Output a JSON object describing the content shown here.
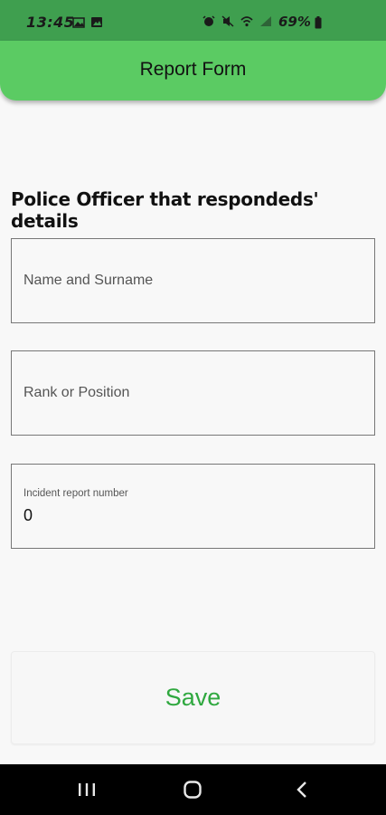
{
  "status_bar": {
    "time": "13:45",
    "battery": "69%",
    "icons": [
      "gallery-notification-icon",
      "image-notification-icon",
      "alarm-icon",
      "mute-icon",
      "wifi-icon",
      "signal-icon",
      "battery-icon"
    ]
  },
  "app_bar": {
    "title": "Report Form"
  },
  "section": {
    "heading": "Police Officer that respondeds' details"
  },
  "fields": {
    "name": {
      "placeholder": "Name and Surname",
      "value": ""
    },
    "rank": {
      "placeholder": "Rank or Position",
      "value": ""
    },
    "incident": {
      "label": "Incident report number",
      "value": "0"
    }
  },
  "save": {
    "label": "Save"
  },
  "nav": [
    "recents-icon",
    "home-icon",
    "back-icon"
  ],
  "colors": {
    "status_bar": "#3f9f4f",
    "app_bar": "#5bcb63",
    "save_text": "#2fa83f",
    "background": "#f8f8f8"
  }
}
